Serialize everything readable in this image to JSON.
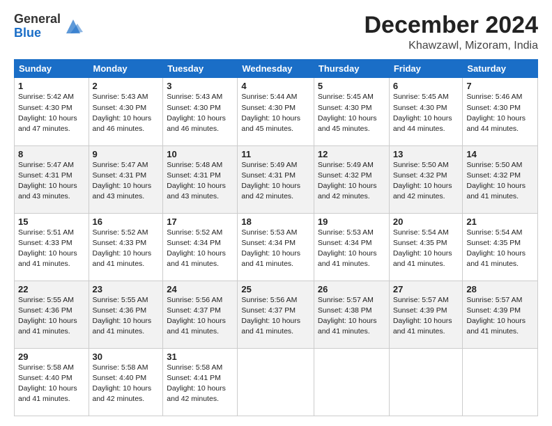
{
  "logo": {
    "line1": "General",
    "line2": "Blue"
  },
  "header": {
    "month": "December 2024",
    "location": "Khawzawl, Mizoram, India"
  },
  "weekdays": [
    "Sunday",
    "Monday",
    "Tuesday",
    "Wednesday",
    "Thursday",
    "Friday",
    "Saturday"
  ],
  "weeks": [
    [
      {
        "day": "1",
        "info": "Sunrise: 5:42 AM\nSunset: 4:30 PM\nDaylight: 10 hours\nand 47 minutes."
      },
      {
        "day": "2",
        "info": "Sunrise: 5:43 AM\nSunset: 4:30 PM\nDaylight: 10 hours\nand 46 minutes."
      },
      {
        "day": "3",
        "info": "Sunrise: 5:43 AM\nSunset: 4:30 PM\nDaylight: 10 hours\nand 46 minutes."
      },
      {
        "day": "4",
        "info": "Sunrise: 5:44 AM\nSunset: 4:30 PM\nDaylight: 10 hours\nand 45 minutes."
      },
      {
        "day": "5",
        "info": "Sunrise: 5:45 AM\nSunset: 4:30 PM\nDaylight: 10 hours\nand 45 minutes."
      },
      {
        "day": "6",
        "info": "Sunrise: 5:45 AM\nSunset: 4:30 PM\nDaylight: 10 hours\nand 44 minutes."
      },
      {
        "day": "7",
        "info": "Sunrise: 5:46 AM\nSunset: 4:30 PM\nDaylight: 10 hours\nand 44 minutes."
      }
    ],
    [
      {
        "day": "8",
        "info": "Sunrise: 5:47 AM\nSunset: 4:31 PM\nDaylight: 10 hours\nand 43 minutes."
      },
      {
        "day": "9",
        "info": "Sunrise: 5:47 AM\nSunset: 4:31 PM\nDaylight: 10 hours\nand 43 minutes."
      },
      {
        "day": "10",
        "info": "Sunrise: 5:48 AM\nSunset: 4:31 PM\nDaylight: 10 hours\nand 43 minutes."
      },
      {
        "day": "11",
        "info": "Sunrise: 5:49 AM\nSunset: 4:31 PM\nDaylight: 10 hours\nand 42 minutes."
      },
      {
        "day": "12",
        "info": "Sunrise: 5:49 AM\nSunset: 4:32 PM\nDaylight: 10 hours\nand 42 minutes."
      },
      {
        "day": "13",
        "info": "Sunrise: 5:50 AM\nSunset: 4:32 PM\nDaylight: 10 hours\nand 42 minutes."
      },
      {
        "day": "14",
        "info": "Sunrise: 5:50 AM\nSunset: 4:32 PM\nDaylight: 10 hours\nand 41 minutes."
      }
    ],
    [
      {
        "day": "15",
        "info": "Sunrise: 5:51 AM\nSunset: 4:33 PM\nDaylight: 10 hours\nand 41 minutes."
      },
      {
        "day": "16",
        "info": "Sunrise: 5:52 AM\nSunset: 4:33 PM\nDaylight: 10 hours\nand 41 minutes."
      },
      {
        "day": "17",
        "info": "Sunrise: 5:52 AM\nSunset: 4:34 PM\nDaylight: 10 hours\nand 41 minutes."
      },
      {
        "day": "18",
        "info": "Sunrise: 5:53 AM\nSunset: 4:34 PM\nDaylight: 10 hours\nand 41 minutes."
      },
      {
        "day": "19",
        "info": "Sunrise: 5:53 AM\nSunset: 4:34 PM\nDaylight: 10 hours\nand 41 minutes."
      },
      {
        "day": "20",
        "info": "Sunrise: 5:54 AM\nSunset: 4:35 PM\nDaylight: 10 hours\nand 41 minutes."
      },
      {
        "day": "21",
        "info": "Sunrise: 5:54 AM\nSunset: 4:35 PM\nDaylight: 10 hours\nand 41 minutes."
      }
    ],
    [
      {
        "day": "22",
        "info": "Sunrise: 5:55 AM\nSunset: 4:36 PM\nDaylight: 10 hours\nand 41 minutes."
      },
      {
        "day": "23",
        "info": "Sunrise: 5:55 AM\nSunset: 4:36 PM\nDaylight: 10 hours\nand 41 minutes."
      },
      {
        "day": "24",
        "info": "Sunrise: 5:56 AM\nSunset: 4:37 PM\nDaylight: 10 hours\nand 41 minutes."
      },
      {
        "day": "25",
        "info": "Sunrise: 5:56 AM\nSunset: 4:37 PM\nDaylight: 10 hours\nand 41 minutes."
      },
      {
        "day": "26",
        "info": "Sunrise: 5:57 AM\nSunset: 4:38 PM\nDaylight: 10 hours\nand 41 minutes."
      },
      {
        "day": "27",
        "info": "Sunrise: 5:57 AM\nSunset: 4:39 PM\nDaylight: 10 hours\nand 41 minutes."
      },
      {
        "day": "28",
        "info": "Sunrise: 5:57 AM\nSunset: 4:39 PM\nDaylight: 10 hours\nand 41 minutes."
      }
    ],
    [
      {
        "day": "29",
        "info": "Sunrise: 5:58 AM\nSunset: 4:40 PM\nDaylight: 10 hours\nand 41 minutes."
      },
      {
        "day": "30",
        "info": "Sunrise: 5:58 AM\nSunset: 4:40 PM\nDaylight: 10 hours\nand 42 minutes."
      },
      {
        "day": "31",
        "info": "Sunrise: 5:58 AM\nSunset: 4:41 PM\nDaylight: 10 hours\nand 42 minutes."
      },
      null,
      null,
      null,
      null
    ]
  ]
}
